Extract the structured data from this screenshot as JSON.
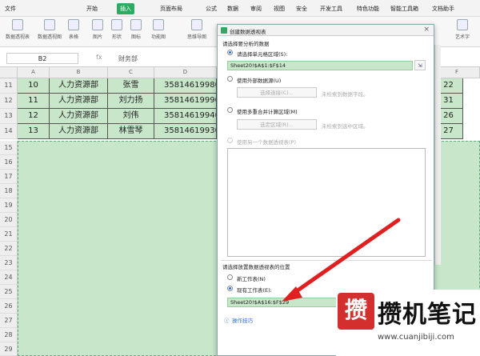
{
  "menu": {
    "file": "文件",
    "tabs": [
      "开始",
      "插入",
      "页面布局",
      "公式",
      "数据",
      "审阅",
      "视图",
      "安全",
      "开发工具",
      "特色功能",
      "智能工具箱",
      "文档助手"
    ],
    "active_tab": "插入"
  },
  "ribbon": [
    "数据透视表",
    "数据透视图",
    "表格",
    "图片",
    "形状",
    "图标",
    "功能图",
    "思维导图",
    "流程图",
    "",
    "",
    "",
    "",
    "",
    "",
    "",
    "艺术字"
  ],
  "formula_bar": {
    "cell_ref": "B2",
    "fx": "fx",
    "content": "财务部"
  },
  "columns": [
    "A",
    "B",
    "C",
    "D",
    "F"
  ],
  "rows": [
    {
      "num": "11",
      "A": "10",
      "B": "人力资源部",
      "C": "张雪",
      "D": "35814619980",
      "F": "22"
    },
    {
      "num": "12",
      "A": "11",
      "B": "人力资源部",
      "C": "刘力扬",
      "D": "35814619990",
      "F": "31"
    },
    {
      "num": "13",
      "A": "12",
      "B": "人力资源部",
      "C": "刘伟",
      "D": "35814619940",
      "F": "26"
    },
    {
      "num": "14",
      "A": "13",
      "B": "人力资源部",
      "C": "林雪琴",
      "D": "35814619930",
      "F": "27"
    }
  ],
  "empty_rows": [
    "15",
    "16",
    "17",
    "18",
    "19",
    "20",
    "21",
    "22",
    "23",
    "24",
    "25",
    "26",
    "27",
    "28",
    "29",
    "30"
  ],
  "dialog": {
    "title": "创建数据透视表",
    "close": "×",
    "section1": "请选择要分析的数据",
    "opt_cell_range": "请选择单元格区域(S):",
    "range_value": "Sheet20!$A$1:$F$14",
    "opt_external": "使用外部数据源(U)",
    "choose_conn": "选择连接(C)...",
    "no_field": "未检索到数据字段。",
    "opt_multi": "使用多重合并计算区域(M)",
    "choose_area": "选定区域(R)...",
    "no_area": "未检索到选中区域。",
    "opt_other": "使用另一个数据透视表(P)",
    "section2": "请选择放置数据透视表的位置",
    "opt_new": "新工作表(N)",
    "opt_existing": "现有工作表(E):",
    "dest_value": "Sheet20!$A$16:$F$29",
    "tips": "操作技巧"
  },
  "watermark": {
    "logo": "攒",
    "text": "攒机笔记",
    "url": "www.cuanjibiji.com"
  }
}
